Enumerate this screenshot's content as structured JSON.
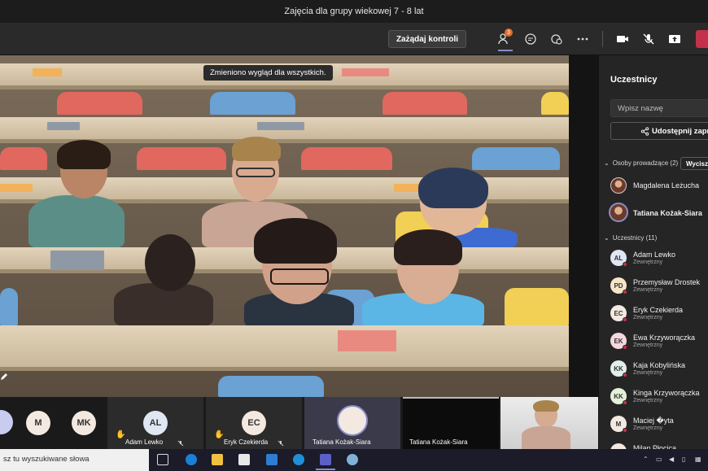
{
  "window": {
    "title": "Zajęcia dla grupy wiekowej 7 - 8 lat"
  },
  "toolbar": {
    "control_label": "Zażądaj kontroli",
    "participants_badge": "3"
  },
  "stage": {
    "toast": "Zmieniono wygląd dla wszystkich."
  },
  "panel": {
    "title": "Uczestnicy",
    "search_placeholder": "Wpisz nazwę",
    "share_label": "Udostępnij zapro",
    "presenters_section": "Osoby prowadzące (2)",
    "mute_all": "Wycisz w",
    "attendees_section": "Uczestnicy (11)",
    "presenters": [
      {
        "name": "Magdalena Leżucha"
      },
      {
        "name": "Tatiana Kożak-Siara"
      }
    ],
    "attendees": [
      {
        "initials": "AL",
        "name": "Adam Lewko",
        "role": "Zewnętrzny",
        "color": "#dfe7f3"
      },
      {
        "initials": "PD",
        "name": "Przemysław Drostek",
        "role": "Zewnętrzny",
        "color": "#f6e6c8"
      },
      {
        "initials": "EC",
        "name": "Eryk Czekierda",
        "role": "Zewnętrzny",
        "color": "#f3e9e0"
      },
      {
        "initials": "EK",
        "name": "Ewa Krzyworączka",
        "role": "Zewnętrzny",
        "color": "#f6d6df"
      },
      {
        "initials": "KK",
        "name": "Kaja Kobylińska",
        "role": "Zewnętrzny",
        "color": "#dff0e8"
      },
      {
        "initials": "KK",
        "name": "Kinga Krzyworączka",
        "role": "Zewnętrzny",
        "color": "#e4f1d9"
      },
      {
        "initials": "M",
        "name": "Maciej �yta",
        "role": "Zewnętrzny",
        "color": "#f3e9e0"
      },
      {
        "initials": "MP",
        "name": "Milan Płocica",
        "role": "",
        "color": "#f3e9e0"
      }
    ]
  },
  "strip": {
    "m_initials": "M",
    "mk_initials": "MK",
    "tiles": [
      {
        "initials": "AL",
        "name": "Adam Lewko"
      },
      {
        "initials": "EC",
        "name": "Eryk Czekierda"
      },
      {
        "initials": "",
        "name": "Tatiana Kożak-Siara"
      },
      {
        "initials": "",
        "name": "Tatiana Kożak-Siara"
      }
    ]
  },
  "taskbar": {
    "search_placeholder": "sz tu wyszukiwane słowa"
  },
  "colors": {
    "leave": "#c4314b",
    "accent": "#6264a7",
    "badge": "#e66b28"
  }
}
